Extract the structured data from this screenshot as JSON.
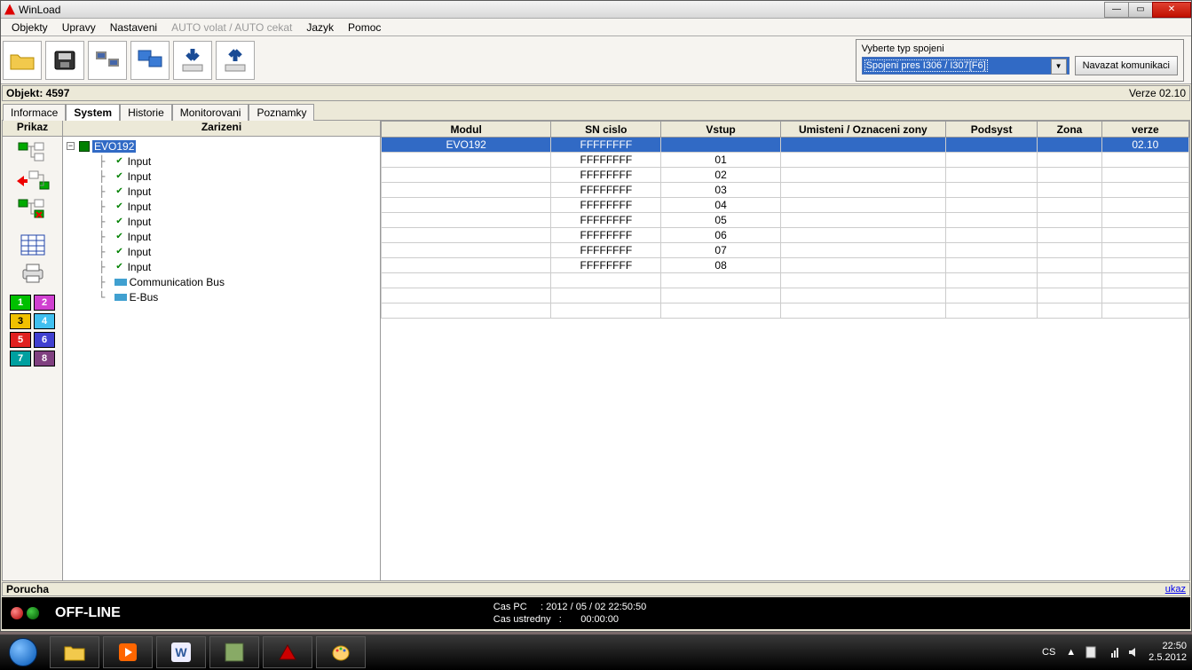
{
  "window": {
    "title": "WinLoad"
  },
  "menu": {
    "items": [
      "Objekty",
      "Upravy",
      "Nastaveni"
    ],
    "disabled": "AUTO volat / AUTO cekat",
    "items2": [
      "Jazyk",
      "Pomoc"
    ]
  },
  "connection": {
    "label": "Vyberte typ spojeni",
    "selected": "Spojeni pres I306 / I307[F6]",
    "button": "Navazat komunikaci"
  },
  "object_bar": {
    "label": "Objekt: 4597",
    "version": "Verze 02.10"
  },
  "tabs": [
    "Informace",
    "System",
    "Historie",
    "Monitorovani",
    "Poznamky"
  ],
  "active_tab": 1,
  "sidebar": {
    "header": "Prikaz",
    "area_colors": [
      "#00c000",
      "#d040d0",
      "#f0c000",
      "#40c0f0",
      "#e02020",
      "#4040d0",
      "#00a0a0",
      "#804080"
    ]
  },
  "tree": {
    "header": "Zarizeni",
    "root": "EVO192",
    "inputs": [
      "Input",
      "Input",
      "Input",
      "Input",
      "Input",
      "Input",
      "Input",
      "Input"
    ],
    "bus1": "Communication Bus",
    "bus2": "E-Bus"
  },
  "grid": {
    "headers": [
      "Modul",
      "SN cislo",
      "Vstup",
      "Umisteni / Oznaceni zony",
      "Podsyst",
      "Zona",
      "verze"
    ],
    "rows": [
      {
        "modul": "EVO192",
        "sn": "FFFFFFFF",
        "vstup": "",
        "umisteni": "",
        "podsyst": "",
        "zona": "",
        "verze": "02.10",
        "selected": true
      },
      {
        "modul": "",
        "sn": "FFFFFFFF",
        "vstup": "01",
        "umisteni": "",
        "podsyst": "",
        "zona": "",
        "verze": ""
      },
      {
        "modul": "",
        "sn": "FFFFFFFF",
        "vstup": "02",
        "umisteni": "",
        "podsyst": "",
        "zona": "",
        "verze": ""
      },
      {
        "modul": "",
        "sn": "FFFFFFFF",
        "vstup": "03",
        "umisteni": "",
        "podsyst": "",
        "zona": "",
        "verze": ""
      },
      {
        "modul": "",
        "sn": "FFFFFFFF",
        "vstup": "04",
        "umisteni": "",
        "podsyst": "",
        "zona": "",
        "verze": ""
      },
      {
        "modul": "",
        "sn": "FFFFFFFF",
        "vstup": "05",
        "umisteni": "",
        "podsyst": "",
        "zona": "",
        "verze": ""
      },
      {
        "modul": "",
        "sn": "FFFFFFFF",
        "vstup": "06",
        "umisteni": "",
        "podsyst": "",
        "zona": "",
        "verze": ""
      },
      {
        "modul": "",
        "sn": "FFFFFFFF",
        "vstup": "07",
        "umisteni": "",
        "podsyst": "",
        "zona": "",
        "verze": ""
      },
      {
        "modul": "",
        "sn": "FFFFFFFF",
        "vstup": "08",
        "umisteni": "",
        "podsyst": "",
        "zona": "",
        "verze": ""
      },
      {
        "modul": "",
        "sn": "",
        "vstup": "",
        "umisteni": "",
        "podsyst": "",
        "zona": "",
        "verze": ""
      },
      {
        "modul": "",
        "sn": "",
        "vstup": "",
        "umisteni": "",
        "podsyst": "",
        "zona": "",
        "verze": ""
      },
      {
        "modul": "",
        "sn": "",
        "vstup": "",
        "umisteni": "",
        "podsyst": "",
        "zona": "",
        "verze": ""
      }
    ]
  },
  "porucha": {
    "label": "Porucha",
    "link": "ukaz"
  },
  "status": {
    "text": "OFF-LINE",
    "pc_label": "Cas PC",
    "pc_time": "2012 / 05 / 02   22:50:50",
    "ustredny_label": "Cas ustredny",
    "ustredny_time": "00:00:00"
  },
  "taskbar": {
    "lang": "CS",
    "time": "22:50",
    "date": "2.5.2012"
  }
}
